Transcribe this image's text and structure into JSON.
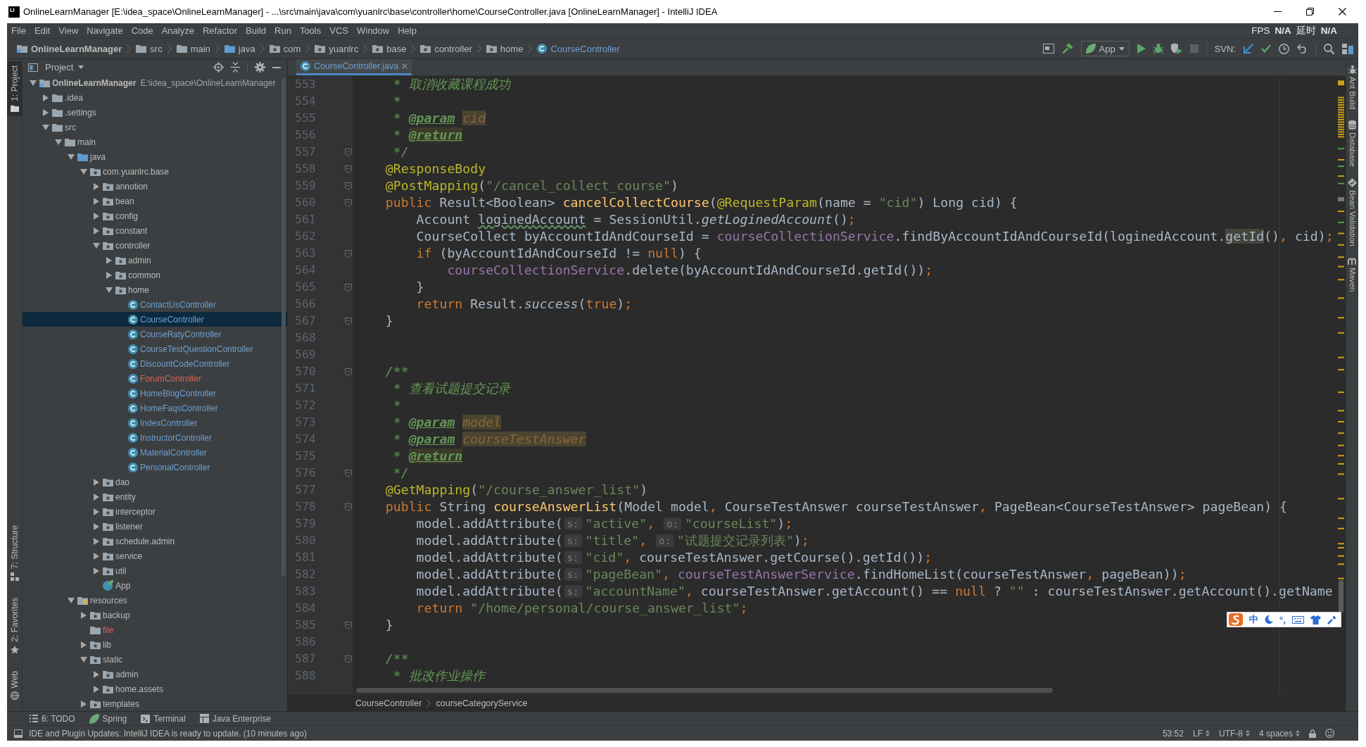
{
  "window": {
    "logo_text": "IJ",
    "title": "OnlineLearnManager [E:\\idea_space\\OnlineLearnManager] - ...\\src\\main\\java\\com\\yuanlrc\\base\\controller\\home\\CourseController.java [OnlineLearnManager] - IntelliJ IDEA"
  },
  "menu": [
    "File",
    "Edit",
    "View",
    "Navigate",
    "Code",
    "Analyze",
    "Refactor",
    "Build",
    "Run",
    "Tools",
    "VCS",
    "Window",
    "Help"
  ],
  "fps_indicator": [
    {
      "label": "FPS",
      "value": "N/A"
    },
    {
      "label": "延时",
      "value": "N/A"
    }
  ],
  "nav_bar": {
    "path": [
      {
        "kind": "module",
        "label": "OnlineLearnManager"
      },
      {
        "kind": "folder",
        "label": "src"
      },
      {
        "kind": "folder",
        "label": "main"
      },
      {
        "kind": "source-folder",
        "label": "java"
      },
      {
        "kind": "package",
        "label": "com"
      },
      {
        "kind": "package",
        "label": "yuanlrc"
      },
      {
        "kind": "package",
        "label": "base"
      },
      {
        "kind": "package",
        "label": "controller"
      },
      {
        "kind": "package",
        "label": "home"
      },
      {
        "kind": "class",
        "label": "CourseController"
      }
    ],
    "run_config": "App",
    "svn_label": "SVN:"
  },
  "left_stripe": {
    "top": [
      {
        "kind": "project",
        "label": "1: Project",
        "selected": true
      }
    ],
    "bottom": [
      {
        "kind": "structure",
        "label": "7: Structure",
        "selected": false
      },
      {
        "kind": "favorites",
        "label": "2: Favorites",
        "selected": false
      },
      {
        "kind": "web",
        "label": "Web",
        "selected": false
      }
    ]
  },
  "project_panel": {
    "title": "Project",
    "tree": [
      {
        "kind": "module",
        "label": "OnlineLearnManager",
        "path": "E:\\idea_space\\OnlineLearnManager",
        "expanded": true,
        "selected": false,
        "color": "#bbbbbb",
        "children": [
          {
            "kind": "folder",
            "label": ".idea",
            "expanded": false,
            "selected": false,
            "color": "#bbbbbb"
          },
          {
            "kind": "folder",
            "label": ".settings",
            "expanded": false,
            "selected": false,
            "color": "#bbbbbb"
          },
          {
            "kind": "folder",
            "label": "src",
            "expanded": true,
            "selected": false,
            "color": "#bbbbbb",
            "children": [
              {
                "kind": "folder",
                "label": "main",
                "expanded": true,
                "selected": false,
                "color": "#bbbbbb",
                "children": [
                  {
                    "kind": "source-folder",
                    "label": "java",
                    "expanded": true,
                    "selected": false,
                    "color": "#bbbbbb",
                    "children": [
                      {
                        "kind": "package",
                        "label": "com.yuanlrc.base",
                        "expanded": true,
                        "selected": false,
                        "color": "#bbbbbb",
                        "children": [
                          {
                            "kind": "package",
                            "label": "annotion",
                            "expanded": false,
                            "selected": false,
                            "color": "#bbbbbb"
                          },
                          {
                            "kind": "package",
                            "label": "bean",
                            "expanded": false,
                            "selected": false,
                            "color": "#bbbbbb"
                          },
                          {
                            "kind": "package",
                            "label": "config",
                            "expanded": false,
                            "selected": false,
                            "color": "#bbbbbb"
                          },
                          {
                            "kind": "package",
                            "label": "constant",
                            "expanded": false,
                            "selected": false,
                            "color": "#bbbbbb"
                          },
                          {
                            "kind": "package",
                            "label": "controller",
                            "expanded": true,
                            "selected": false,
                            "color": "#bbbbbb",
                            "children": [
                              {
                                "kind": "package",
                                "label": "admin",
                                "expanded": false,
                                "selected": false,
                                "color": "#bbbbbb"
                              },
                              {
                                "kind": "package",
                                "label": "common",
                                "expanded": false,
                                "selected": false,
                                "color": "#bbbbbb"
                              },
                              {
                                "kind": "package",
                                "label": "home",
                                "expanded": true,
                                "selected": false,
                                "color": "#bbbbbb",
                                "children": [
                                  {
                                    "kind": "class",
                                    "label": "ContactUsController",
                                    "selected": false,
                                    "color": "#6d9fd0"
                                  },
                                  {
                                    "kind": "class",
                                    "label": "CourseController",
                                    "selected": true,
                                    "color": "#6d9fd0"
                                  },
                                  {
                                    "kind": "class",
                                    "label": "CourseRatyController",
                                    "selected": false,
                                    "color": "#6d9fd0"
                                  },
                                  {
                                    "kind": "class",
                                    "label": "CourseTestQuestionController",
                                    "selected": false,
                                    "color": "#6d9fd0"
                                  },
                                  {
                                    "kind": "class",
                                    "label": "DiscountCodeController",
                                    "selected": false,
                                    "color": "#6d9fd0"
                                  },
                                  {
                                    "kind": "class",
                                    "label": "ForumController",
                                    "selected": false,
                                    "color": "#d1675a"
                                  },
                                  {
                                    "kind": "class",
                                    "label": "HomeBlogController",
                                    "selected": false,
                                    "color": "#6d9fd0"
                                  },
                                  {
                                    "kind": "class",
                                    "label": "HomeFaqsController",
                                    "selected": false,
                                    "color": "#6d9fd0"
                                  },
                                  {
                                    "kind": "class",
                                    "label": "IndexController",
                                    "selected": false,
                                    "color": "#6d9fd0"
                                  },
                                  {
                                    "kind": "class",
                                    "label": "InstructorController",
                                    "selected": false,
                                    "color": "#6d9fd0"
                                  },
                                  {
                                    "kind": "class",
                                    "label": "MaterialController",
                                    "selected": false,
                                    "color": "#6d9fd0"
                                  },
                                  {
                                    "kind": "class",
                                    "label": "PersonalController",
                                    "selected": false,
                                    "color": "#6d9fd0"
                                  }
                                ]
                              }
                            ]
                          },
                          {
                            "kind": "package",
                            "label": "dao",
                            "expanded": false,
                            "selected": false,
                            "color": "#bbbbbb"
                          },
                          {
                            "kind": "package",
                            "label": "entity",
                            "expanded": false,
                            "selected": false,
                            "color": "#bbbbbb"
                          },
                          {
                            "kind": "package",
                            "label": "interceptor",
                            "expanded": false,
                            "selected": false,
                            "color": "#bbbbbb"
                          },
                          {
                            "kind": "package",
                            "label": "listener",
                            "expanded": false,
                            "selected": false,
                            "color": "#bbbbbb"
                          },
                          {
                            "kind": "package",
                            "label": "schedule.admin",
                            "expanded": false,
                            "selected": false,
                            "color": "#bbbbbb"
                          },
                          {
                            "kind": "package",
                            "label": "service",
                            "expanded": false,
                            "selected": false,
                            "color": "#bbbbbb"
                          },
                          {
                            "kind": "package",
                            "label": "util",
                            "expanded": false,
                            "selected": false,
                            "color": "#bbbbbb"
                          },
                          {
                            "kind": "spring-app",
                            "label": "App",
                            "selected": false,
                            "color": "#bbbbbb"
                          }
                        ]
                      }
                    ]
                  },
                  {
                    "kind": "resources",
                    "label": "resources",
                    "expanded": true,
                    "selected": false,
                    "color": "#bbbbbb",
                    "children": [
                      {
                        "kind": "package",
                        "label": "backup",
                        "expanded": false,
                        "selected": false,
                        "color": "#bbbbbb"
                      },
                      {
                        "kind": "folder",
                        "label": "file",
                        "selected": false,
                        "color": "#d1675a"
                      },
                      {
                        "kind": "package",
                        "label": "lib",
                        "expanded": false,
                        "selected": false,
                        "color": "#bbbbbb"
                      },
                      {
                        "kind": "package",
                        "label": "static",
                        "expanded": true,
                        "selected": false,
                        "color": "#bbbbbb",
                        "children": [
                          {
                            "kind": "package",
                            "label": "admin",
                            "expanded": false,
                            "selected": false,
                            "color": "#bbbbbb"
                          },
                          {
                            "kind": "package",
                            "label": "home.assets",
                            "expanded": false,
                            "selected": false,
                            "color": "#bbbbbb"
                          }
                        ]
                      },
                      {
                        "kind": "package",
                        "label": "templates",
                        "expanded": false,
                        "selected": false,
                        "color": "#bbbbbb"
                      }
                    ]
                  }
                ]
              }
            ]
          }
        ]
      }
    ]
  },
  "editor": {
    "tabs": [
      {
        "label": "CourseController.java",
        "selected": true
      }
    ],
    "lines": [
      {
        "number": "553",
        "fold": false,
        "tokens": [
          {
            "kind": "comment",
            "text": "     * 取消收藏课程成功"
          }
        ]
      },
      {
        "number": "554",
        "fold": false,
        "tokens": [
          {
            "kind": "comment",
            "text": "     *"
          }
        ]
      },
      {
        "number": "555",
        "fold": false,
        "tokens": [
          {
            "kind": "comment",
            "text": "     * "
          },
          {
            "kind": "doc-tag",
            "text": "@param "
          },
          {
            "kind": "doc-value",
            "text": "cid"
          }
        ]
      },
      {
        "number": "556",
        "fold": false,
        "tokens": [
          {
            "kind": "comment",
            "text": "     * "
          },
          {
            "kind": "doc-tag-warn",
            "text": "@return"
          }
        ]
      },
      {
        "number": "557",
        "fold": true,
        "tokens": [
          {
            "kind": "comment",
            "text": "     */"
          }
        ]
      },
      {
        "number": "558",
        "fold": true,
        "tokens": [
          {
            "kind": "annotation",
            "text": "    @ResponseBody"
          }
        ]
      },
      {
        "number": "559",
        "fold": true,
        "tokens": [
          {
            "kind": "annotation",
            "text": "    @PostMapping"
          },
          {
            "kind": "plain",
            "text": "("
          },
          {
            "kind": "string",
            "text": "\"/cancel_collect_course\""
          },
          {
            "kind": "plain",
            "text": ")"
          }
        ]
      },
      {
        "number": "560",
        "fold": true,
        "tokens": [
          {
            "kind": "keyword",
            "text": "    public"
          },
          {
            "kind": "plain",
            "text": " Result<Boolean> "
          },
          {
            "kind": "method-decl",
            "text": "cancelCollectCourse"
          },
          {
            "kind": "plain",
            "text": "("
          },
          {
            "kind": "annotation",
            "text": "@RequestParam"
          },
          {
            "kind": "plain",
            "text": "(name = "
          },
          {
            "kind": "string",
            "text": "\"cid\""
          },
          {
            "kind": "plain",
            "text": ") Long cid) {"
          }
        ]
      },
      {
        "number": "561",
        "fold": false,
        "tokens": [
          {
            "kind": "plain",
            "text": "        Account "
          },
          {
            "kind": "typo",
            "text": "loginedAccount"
          },
          {
            "kind": "plain",
            "text": " = SessionUtil."
          },
          {
            "kind": "static-call",
            "text": "getLoginedAccount"
          },
          {
            "kind": "plain",
            "text": "()"
          },
          {
            "kind": "keyword",
            "text": ";"
          }
        ]
      },
      {
        "number": "562",
        "fold": false,
        "tokens": [
          {
            "kind": "plain",
            "text": "        CourseCollect byAccountIdAndCourseId = "
          },
          {
            "kind": "field",
            "text": "courseCollectionService"
          },
          {
            "kind": "plain",
            "text": ".findByAccountIdAndCourseId(loginedAccount."
          },
          {
            "kind": "usage",
            "text": "getId"
          },
          {
            "kind": "plain",
            "text": "()"
          },
          {
            "kind": "keyword",
            "text": ","
          },
          {
            "kind": "plain",
            "text": " cid)"
          },
          {
            "kind": "keyword",
            "text": ";"
          }
        ]
      },
      {
        "number": "563",
        "fold": true,
        "tokens": [
          {
            "kind": "keyword",
            "text": "        if"
          },
          {
            "kind": "plain",
            "text": " (byAccountIdAndCourseId != "
          },
          {
            "kind": "keyword",
            "text": "null"
          },
          {
            "kind": "plain",
            "text": ") {"
          }
        ]
      },
      {
        "number": "564",
        "fold": false,
        "tokens": [
          {
            "kind": "field",
            "text": "            courseCollectionService"
          },
          {
            "kind": "plain",
            "text": ".delete(byAccountIdAndCourseId.getId())"
          },
          {
            "kind": "keyword",
            "text": ";"
          }
        ]
      },
      {
        "number": "565",
        "fold": true,
        "tokens": [
          {
            "kind": "plain",
            "text": "        }"
          }
        ]
      },
      {
        "number": "566",
        "fold": false,
        "tokens": [
          {
            "kind": "keyword",
            "text": "        return"
          },
          {
            "kind": "plain",
            "text": " Result."
          },
          {
            "kind": "static-call",
            "text": "success"
          },
          {
            "kind": "plain",
            "text": "("
          },
          {
            "kind": "keyword",
            "text": "true"
          },
          {
            "kind": "plain",
            "text": ")"
          },
          {
            "kind": "keyword",
            "text": ";"
          }
        ]
      },
      {
        "number": "567",
        "fold": true,
        "tokens": [
          {
            "kind": "plain",
            "text": "    }"
          }
        ]
      },
      {
        "number": "568",
        "fold": false
      },
      {
        "number": "569",
        "fold": false
      },
      {
        "number": "570",
        "fold": true,
        "tokens": [
          {
            "kind": "comment",
            "text": "    /**"
          }
        ]
      },
      {
        "number": "571",
        "fold": false,
        "tokens": [
          {
            "kind": "comment",
            "text": "     * 查看试题提交记录"
          }
        ]
      },
      {
        "number": "572",
        "fold": false,
        "tokens": [
          {
            "kind": "comment",
            "text": "     *"
          }
        ]
      },
      {
        "number": "573",
        "fold": false,
        "tokens": [
          {
            "kind": "comment",
            "text": "     * "
          },
          {
            "kind": "doc-tag",
            "text": "@param "
          },
          {
            "kind": "doc-value",
            "text": "model"
          }
        ]
      },
      {
        "number": "574",
        "fold": false,
        "tokens": [
          {
            "kind": "comment",
            "text": "     * "
          },
          {
            "kind": "doc-tag",
            "text": "@param "
          },
          {
            "kind": "doc-value",
            "text": "courseTestAnswer"
          }
        ]
      },
      {
        "number": "575",
        "fold": false,
        "tokens": [
          {
            "kind": "comment",
            "text": "     * "
          },
          {
            "kind": "doc-tag-warn",
            "text": "@return"
          }
        ]
      },
      {
        "number": "576",
        "fold": true,
        "tokens": [
          {
            "kind": "comment",
            "text": "     */"
          }
        ]
      },
      {
        "number": "577",
        "fold": false,
        "tokens": [
          {
            "kind": "annotation",
            "text": "    @GetMapping"
          },
          {
            "kind": "plain",
            "text": "("
          },
          {
            "kind": "string",
            "text": "\"/course_answer_list\""
          },
          {
            "kind": "plain",
            "text": ")"
          }
        ]
      },
      {
        "number": "578",
        "fold": true,
        "tokens": [
          {
            "kind": "keyword",
            "text": "    public"
          },
          {
            "kind": "plain",
            "text": " String "
          },
          {
            "kind": "method-decl",
            "text": "courseAnswerList"
          },
          {
            "kind": "plain",
            "text": "(Model model"
          },
          {
            "kind": "keyword",
            "text": ","
          },
          {
            "kind": "plain",
            "text": " CourseTestAnswer courseTestAnswer"
          },
          {
            "kind": "keyword",
            "text": ","
          },
          {
            "kind": "plain",
            "text": " PageBean<CourseTestAnswer> pageBean) {"
          }
        ]
      },
      {
        "number": "579",
        "fold": false,
        "tokens": [
          {
            "kind": "plain",
            "text": "        model.addAttribute("
          },
          {
            "kind": "hint",
            "text": "s:"
          },
          {
            "kind": "string",
            "text": "\"active\""
          },
          {
            "kind": "keyword",
            "text": ", "
          },
          {
            "kind": "hint",
            "text": "o:"
          },
          {
            "kind": "string",
            "text": "\"courseList\""
          },
          {
            "kind": "plain",
            "text": ")"
          },
          {
            "kind": "keyword",
            "text": ";"
          }
        ]
      },
      {
        "number": "580",
        "fold": false,
        "tokens": [
          {
            "kind": "plain",
            "text": "        model.addAttribute("
          },
          {
            "kind": "hint",
            "text": "s:"
          },
          {
            "kind": "string",
            "text": "\"title\""
          },
          {
            "kind": "keyword",
            "text": ", "
          },
          {
            "kind": "hint",
            "text": "o:"
          },
          {
            "kind": "string",
            "text": "\"试题提交记录列表\""
          },
          {
            "kind": "plain",
            "text": ")"
          },
          {
            "kind": "keyword",
            "text": ";"
          }
        ]
      },
      {
        "number": "581",
        "fold": false,
        "tokens": [
          {
            "kind": "plain",
            "text": "        model.addAttribute("
          },
          {
            "kind": "hint",
            "text": "s:"
          },
          {
            "kind": "string",
            "text": "\"cid\""
          },
          {
            "kind": "keyword",
            "text": ","
          },
          {
            "kind": "plain",
            "text": " courseTestAnswer.getCourse().getId())"
          },
          {
            "kind": "keyword",
            "text": ";"
          }
        ]
      },
      {
        "number": "582",
        "fold": false,
        "tokens": [
          {
            "kind": "plain",
            "text": "        model.addAttribute("
          },
          {
            "kind": "hint",
            "text": "s:"
          },
          {
            "kind": "string",
            "text": "\"pageBean\""
          },
          {
            "kind": "keyword",
            "text": ", "
          },
          {
            "kind": "field",
            "text": "courseTestAnswerService"
          },
          {
            "kind": "plain",
            "text": ".findHomeList(courseTestAnswer"
          },
          {
            "kind": "keyword",
            "text": ","
          },
          {
            "kind": "plain",
            "text": " pageBean))"
          },
          {
            "kind": "keyword",
            "text": ";"
          }
        ]
      },
      {
        "number": "583",
        "fold": false,
        "tokens": [
          {
            "kind": "plain",
            "text": "        model.addAttribute("
          },
          {
            "kind": "hint",
            "text": "s:"
          },
          {
            "kind": "string",
            "text": "\"accountName\""
          },
          {
            "kind": "keyword",
            "text": ","
          },
          {
            "kind": "plain",
            "text": " courseTestAnswer.getAccount() == "
          },
          {
            "kind": "keyword",
            "text": "null"
          },
          {
            "kind": "plain",
            "text": " ? "
          },
          {
            "kind": "string",
            "text": "\"\""
          },
          {
            "kind": "plain",
            "text": " : courseTestAnswer.getAccount().getName"
          }
        ]
      },
      {
        "number": "584",
        "fold": false,
        "tokens": [
          {
            "kind": "keyword",
            "text": "        return "
          },
          {
            "kind": "string",
            "text": "\"/home/personal/course_answer_list\""
          },
          {
            "kind": "keyword",
            "text": ";"
          }
        ]
      },
      {
        "number": "585",
        "fold": true,
        "tokens": [
          {
            "kind": "plain",
            "text": "    }"
          }
        ]
      },
      {
        "number": "586",
        "fold": false
      },
      {
        "number": "587",
        "fold": true,
        "tokens": [
          {
            "kind": "comment",
            "text": "    /**"
          }
        ]
      },
      {
        "number": "588",
        "fold": false,
        "tokens": [
          {
            "kind": "comment",
            "text": "     * 批改作业操作"
          }
        ]
      }
    ],
    "breadcrumb": [
      "CourseController",
      "courseCategoryService"
    ]
  },
  "right_stripe": [
    {
      "kind": "ant",
      "label": "Ant Build"
    },
    {
      "kind": "database",
      "label": "Database"
    },
    {
      "kind": "bean",
      "label": "Bean Validation"
    },
    {
      "kind": "maven",
      "label": "Maven"
    }
  ],
  "ime_toolbar": {
    "mode": "中",
    "punctuation": "°,"
  },
  "bottom_tools": [
    {
      "kind": "todo",
      "label": "6: TODO"
    },
    {
      "kind": "spring",
      "label": "Spring"
    },
    {
      "kind": "terminal",
      "label": "Terminal"
    },
    {
      "kind": "java-ee",
      "label": "Java Enterprise"
    }
  ],
  "status_bar": {
    "message": "IDE and Plugin Updates: IntelliJ IDEA is ready to update. (10 minutes ago)",
    "position": "53:52",
    "line_separator": "LF",
    "encoding": "UTF-8",
    "indent": "4 spaces"
  }
}
